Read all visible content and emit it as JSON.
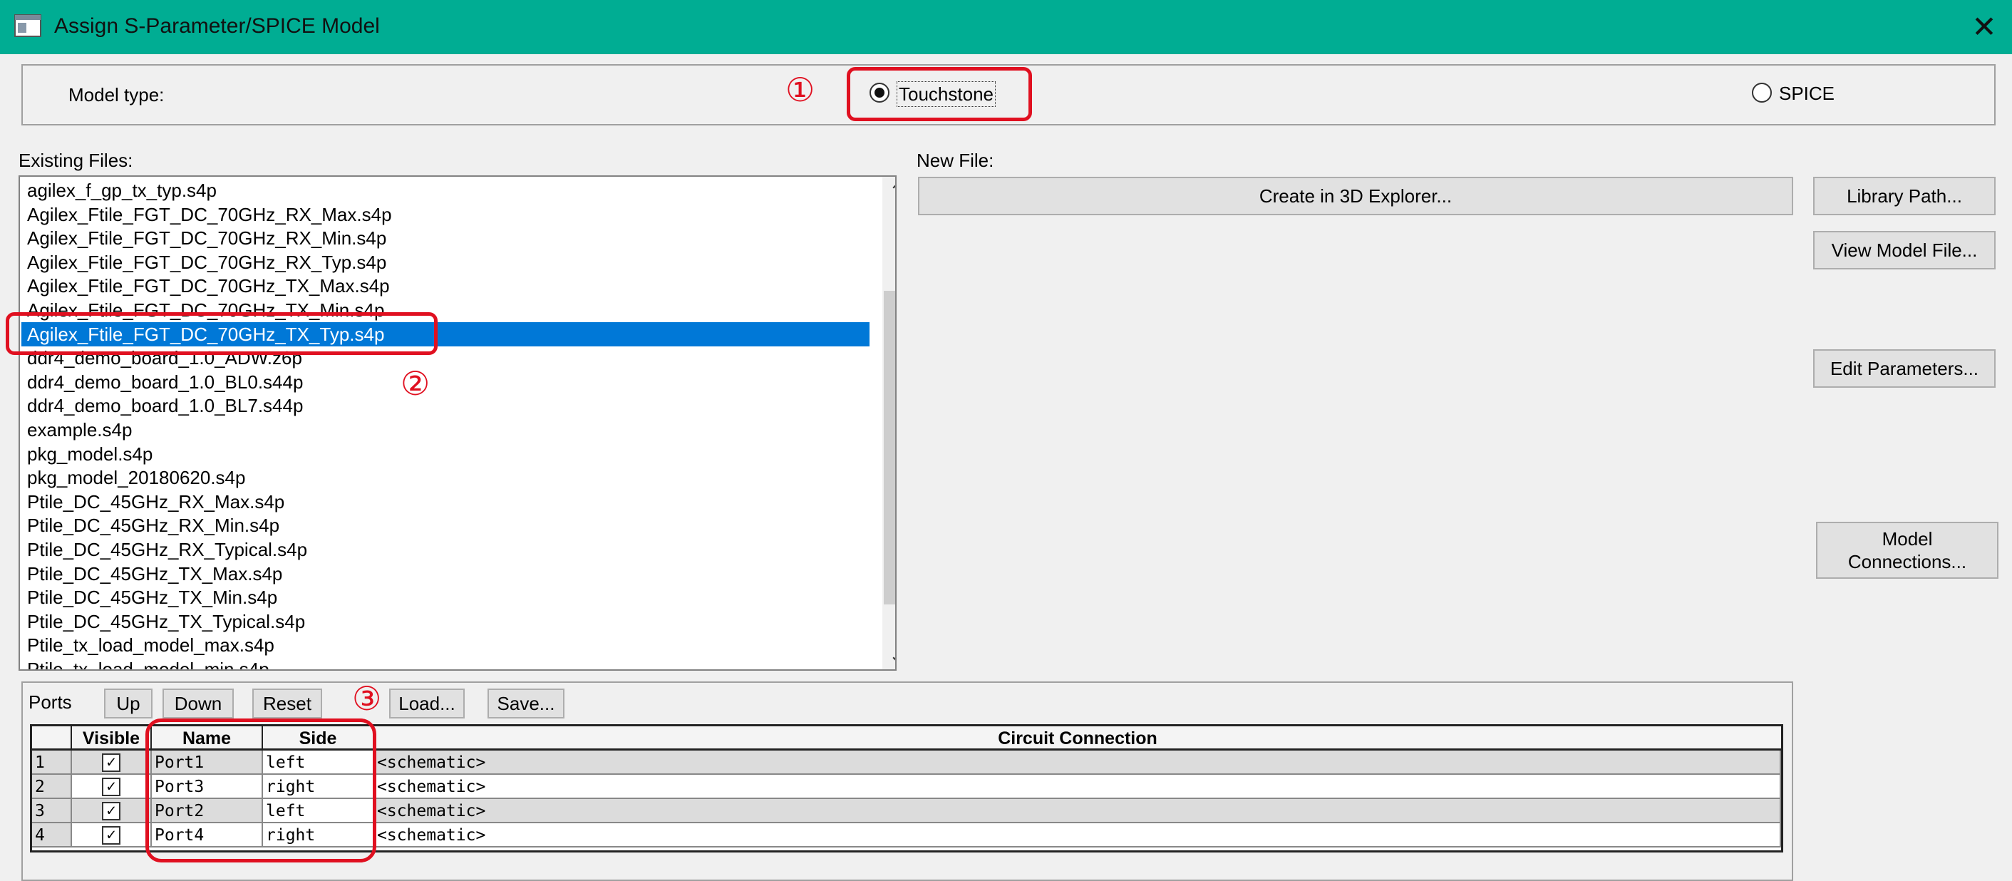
{
  "window": {
    "title": "Assign S-Parameter/SPICE Model",
    "close_glyph": "✕"
  },
  "model_type": {
    "label": "Model type:",
    "options": [
      "Touchstone",
      "SPICE"
    ],
    "selected": "Touchstone"
  },
  "existing_files": {
    "label": "Existing Files:",
    "items": [
      "agilex_f_gp_tx_typ.s4p",
      "Agilex_Ftile_FGT_DC_70GHz_RX_Max.s4p",
      "Agilex_Ftile_FGT_DC_70GHz_RX_Min.s4p",
      "Agilex_Ftile_FGT_DC_70GHz_RX_Typ.s4p",
      "Agilex_Ftile_FGT_DC_70GHz_TX_Max.s4p",
      "Agilex_Ftile_FGT_DC_70GHz_TX_Min.s4p",
      "Agilex_Ftile_FGT_DC_70GHz_TX_Typ.s4p",
      "ddr4_demo_board_1.0_ADW.z6p",
      "ddr4_demo_board_1.0_BL0.s44p",
      "ddr4_demo_board_1.0_BL7.s44p",
      "example.s4p",
      "pkg_model.s4p",
      "pkg_model_20180620.s4p",
      "Ptile_DC_45GHz_RX_Max.s4p",
      "Ptile_DC_45GHz_RX_Min.s4p",
      "Ptile_DC_45GHz_RX_Typical.s4p",
      "Ptile_DC_45GHz_TX_Max.s4p",
      "Ptile_DC_45GHz_TX_Min.s4p",
      "Ptile_DC_45GHz_TX_Typical.s4p",
      "Ptile_tx_load_model_max.s4p",
      "Ptile_tx_load_model_min.s4p"
    ],
    "selected_index": 6
  },
  "new_file": {
    "label": "New File:",
    "create_button": "Create in 3D Explorer..."
  },
  "side_buttons": {
    "library_path": "Library Path...",
    "view_model_file": "View Model File...",
    "edit_parameters": "Edit Parameters...",
    "model_connections_line1": "Model",
    "model_connections_line2": "Connections..."
  },
  "ports": {
    "label": "Ports",
    "buttons": {
      "up": "Up",
      "down": "Down",
      "reset": "Reset",
      "load": "Load...",
      "save": "Save..."
    },
    "columns": {
      "visible": "Visible",
      "name": "Name",
      "side": "Side",
      "circuit": "Circuit Connection"
    },
    "rows": [
      {
        "index": "1",
        "visible": true,
        "name": "Port1",
        "side": "left",
        "circuit": "<schematic>"
      },
      {
        "index": "2",
        "visible": true,
        "name": "Port3",
        "side": "right",
        "circuit": "<schematic>"
      },
      {
        "index": "3",
        "visible": true,
        "name": "Port2",
        "side": "left",
        "circuit": "<schematic>"
      },
      {
        "index": "4",
        "visible": true,
        "name": "Port4",
        "side": "right",
        "circuit": "<schematic>"
      }
    ]
  },
  "annotations": {
    "n1": "①",
    "n2": "②",
    "n3": "③"
  },
  "colors": {
    "titlebar": "#00ad93",
    "selection": "#0078d7",
    "annotation": "#e01020"
  }
}
